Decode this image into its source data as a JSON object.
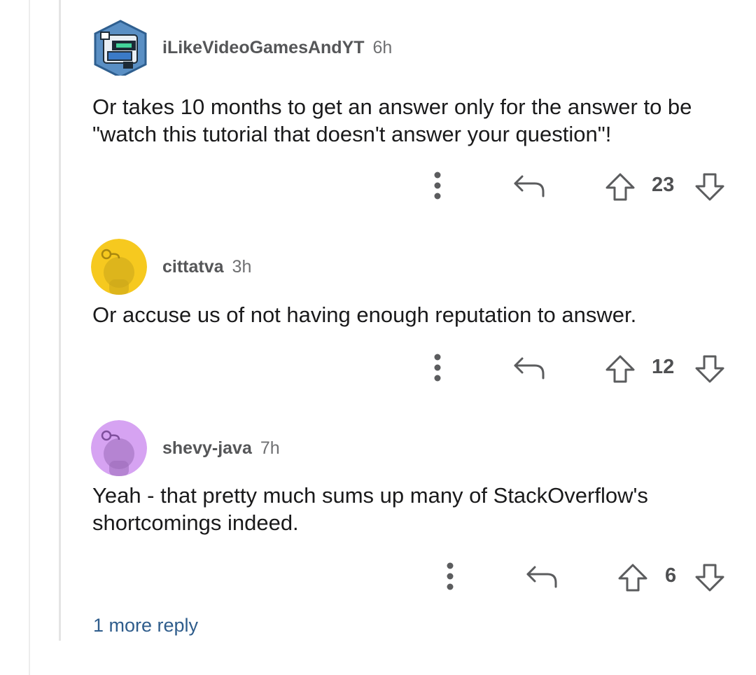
{
  "thread": {
    "comments": [
      {
        "username": "iLikeVideoGamesAndYT",
        "time": "6h",
        "avatar_icon": "robot-avatar-icon",
        "body": "Or takes 10 months to get an answer only for the answer to be \"watch this tutorial that doesn't answer your question\"!",
        "score": "23"
      },
      {
        "username": "cittatva",
        "time": "3h",
        "avatar_icon": "snoo-avatar-icon",
        "avatar_color": "#f6c91f",
        "body": "Or accuse us of not having enough reputation to answer.",
        "score": "12"
      },
      {
        "username": "shevy-java",
        "time": "7h",
        "avatar_icon": "snoo-avatar-icon",
        "avatar_color": "#d6a3f2",
        "body": "Yeah - that pretty much sums up many of StackOverflow's shortcomings indeed.",
        "score": "6"
      }
    ],
    "more_replies_label": "1 more reply"
  },
  "colors": {
    "text": "#1a1a1b",
    "meta": "#6f7072",
    "link": "#2f5d8c",
    "icon": "#5b5c5e"
  }
}
